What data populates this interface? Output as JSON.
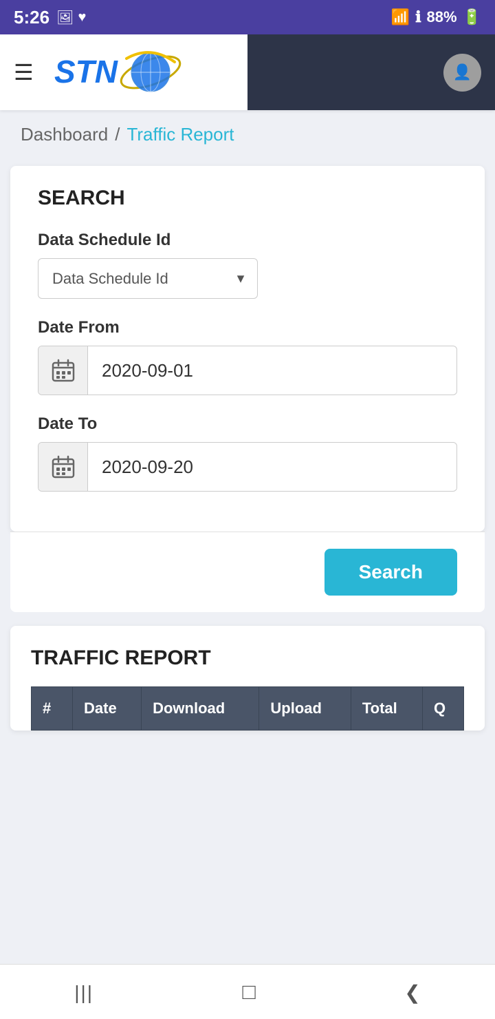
{
  "statusBar": {
    "time": "5:26",
    "battery": "88%",
    "batteryIcon": "🔋",
    "wifiIcon": "📶",
    "signalIcon": "📶",
    "photoIcon": "🖼",
    "heartIcon": "❤"
  },
  "header": {
    "logoText": "STN",
    "hamburgerIcon": "☰",
    "avatarIcon": "👤"
  },
  "breadcrumb": {
    "dashboard": "Dashboard",
    "separator": "/",
    "current": "Traffic Report"
  },
  "searchSection": {
    "title": "SEARCH",
    "dataScheduleId": {
      "label": "Data Schedule Id",
      "placeholder": "Data Schedule Id",
      "options": [
        "Data Schedule Id"
      ]
    },
    "dateFrom": {
      "label": "Date From",
      "value": "2020-09-01"
    },
    "dateTo": {
      "label": "Date To",
      "value": "2020-09-20"
    },
    "searchButton": "Search"
  },
  "trafficReport": {
    "title": "TRAFFIC REPORT",
    "tableHeaders": [
      "#",
      "Date",
      "Download",
      "Upload",
      "Total",
      "Q"
    ]
  },
  "bottomNav": {
    "backIcon": "❮",
    "homeIcon": "⬜",
    "menuIcon": "|||"
  }
}
